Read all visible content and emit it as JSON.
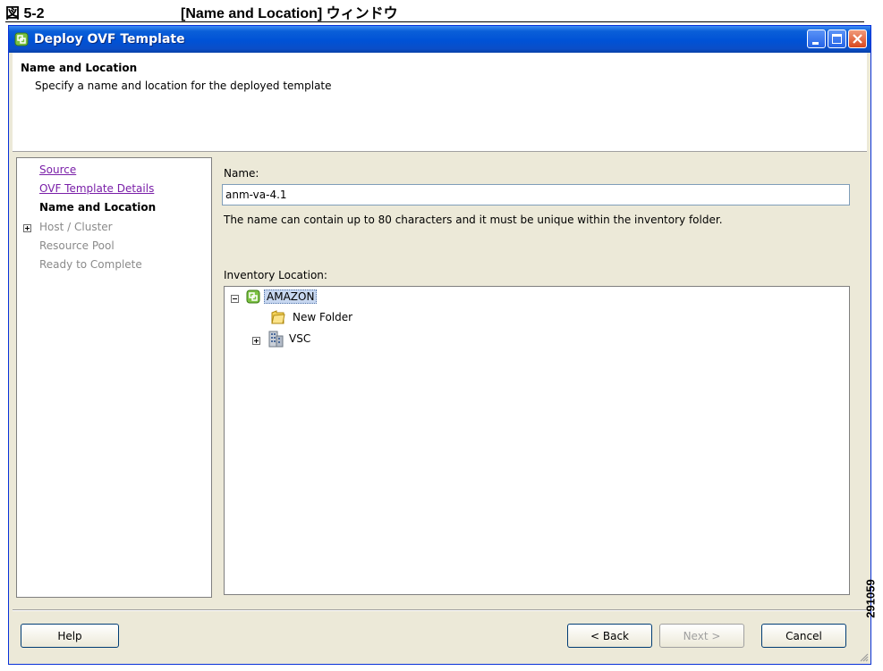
{
  "caption": {
    "figure": "図 5-2",
    "title": "[Name and Location] ウィンドウ"
  },
  "window": {
    "title": "Deploy OVF Template"
  },
  "header": {
    "title": "Name and Location",
    "subtitle": "Specify a name and location for the deployed template"
  },
  "nav": {
    "items": [
      {
        "label": "Source",
        "state": "link"
      },
      {
        "label": "OVF Template Details",
        "state": "link"
      },
      {
        "label": "Name and Location",
        "state": "current"
      },
      {
        "label": "Host / Cluster",
        "state": "disabled",
        "expander": "plus"
      },
      {
        "label": "Resource Pool",
        "state": "disabled"
      },
      {
        "label": "Ready to Complete",
        "state": "disabled"
      }
    ]
  },
  "form": {
    "name_label": "Name:",
    "name_value": "anm-va-4.1",
    "name_hint": "The name can contain up to 80 characters and it must be unique within the inventory folder.",
    "inventory_label": "Inventory Location:"
  },
  "tree": {
    "root": "AMAZON",
    "children": [
      "New Folder",
      "VSC"
    ]
  },
  "buttons": {
    "help": "Help",
    "back": "< Back",
    "next": "Next >",
    "cancel": "Cancel"
  },
  "figure_number": "291059"
}
